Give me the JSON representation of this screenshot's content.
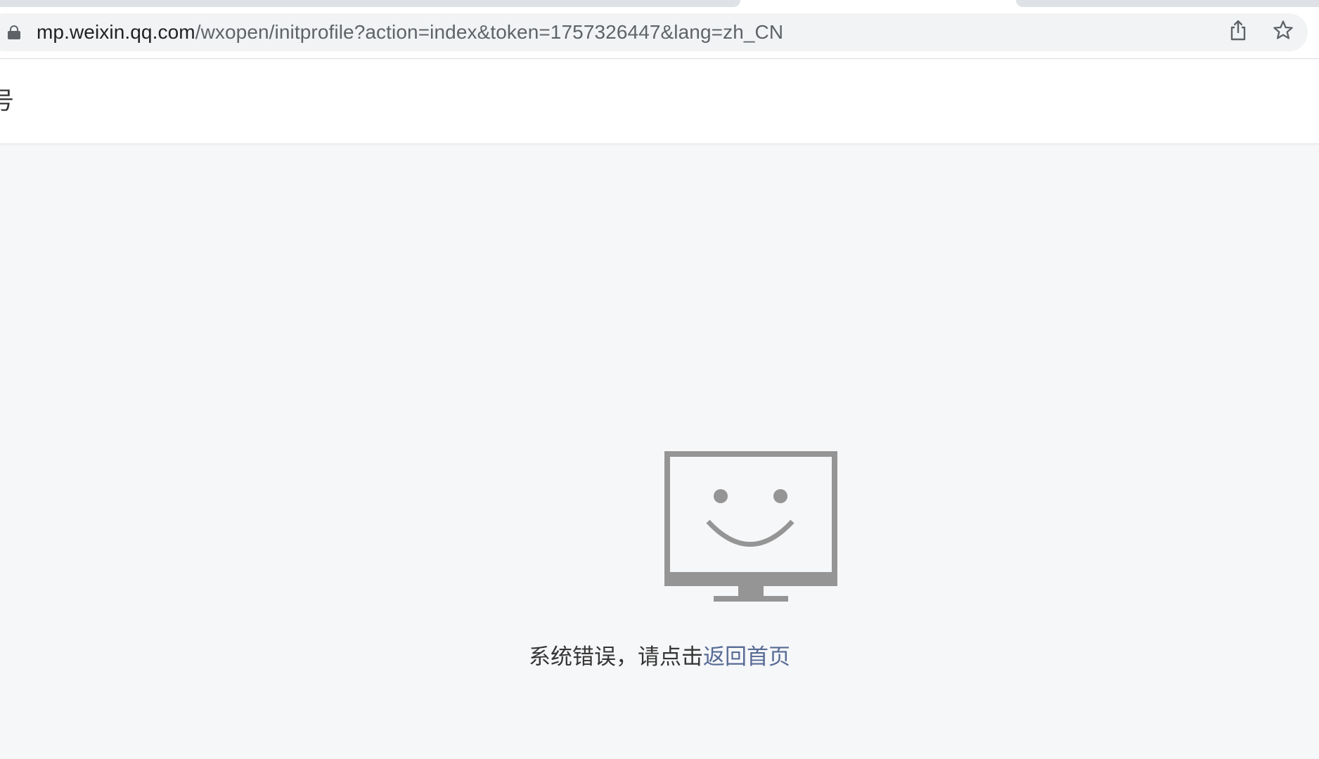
{
  "browser": {
    "url_host": "mp.weixin.qq.com",
    "url_path": "/wxopen/initprofile?action=index&token=1757326447&lang=zh_CN"
  },
  "header": {
    "partial_title": "号"
  },
  "error": {
    "message": "系统错误，请点击",
    "link_label": "返回首页"
  },
  "colors": {
    "page_bg": "#f6f7f9",
    "icon_gray": "#959595",
    "link_blue": "#576b95",
    "text": "#353535"
  },
  "icons": {
    "lock": "lock-icon",
    "share": "share-icon",
    "bookmark": "star-icon",
    "error_illustration": "smiling-monitor-icon"
  }
}
